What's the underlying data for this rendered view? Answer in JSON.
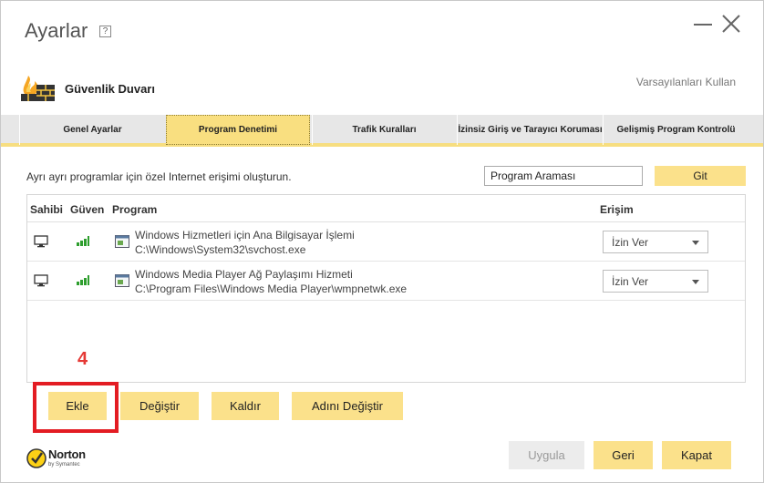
{
  "window": {
    "title": "Ayarlar",
    "help_label": "?"
  },
  "header": {
    "section_title": "Güvenlik Duvarı",
    "defaults_link": "Varsayılanları Kullan"
  },
  "tabs": [
    {
      "label": "Genel Ayarlar",
      "active": false
    },
    {
      "label": "Program Denetimi",
      "active": true
    },
    {
      "label": "Trafik Kuralları",
      "active": false
    },
    {
      "label": "İzinsiz Giriş ve Tarayıcı Koruması",
      "active": false
    },
    {
      "label": "Gelişmiş Program Kontrolü",
      "active": false
    }
  ],
  "main": {
    "description": "Ayrı ayrı programlar için özel Internet erişimi oluşturun.",
    "search_value": "Program Araması",
    "go_label": "Git"
  },
  "table": {
    "columns": [
      "Sahibi",
      "Güven",
      "Program",
      "Erişim"
    ],
    "rows": [
      {
        "owner_icon": "computer-icon",
        "trust_icon": "signal-bars-icon",
        "name": "Windows Hizmetleri için Ana Bilgisayar İşlemi",
        "path": "C:\\Windows\\System32\\svchost.exe",
        "access": "İzin Ver"
      },
      {
        "owner_icon": "computer-icon",
        "trust_icon": "signal-bars-icon",
        "name": "Windows Media Player Ağ Paylaşımı Hizmeti",
        "path": "C:\\Program Files\\Windows Media Player\\wmpnetwk.exe",
        "access": "İzin Ver"
      }
    ]
  },
  "actions": {
    "add": "Ekle",
    "modify": "Değiştir",
    "remove": "Kaldır",
    "rename": "Adını Değiştir"
  },
  "annotation": {
    "step": "4",
    "color": "#e31c23"
  },
  "footer": {
    "apply": "Uygula",
    "back": "Geri",
    "close": "Kapat",
    "logo_name": "Norton",
    "logo_sub": "by Symantec"
  },
  "colors": {
    "accent": "#fbe18b",
    "tab_active": "#f9df80",
    "trust_green": "#2e9e2e"
  }
}
